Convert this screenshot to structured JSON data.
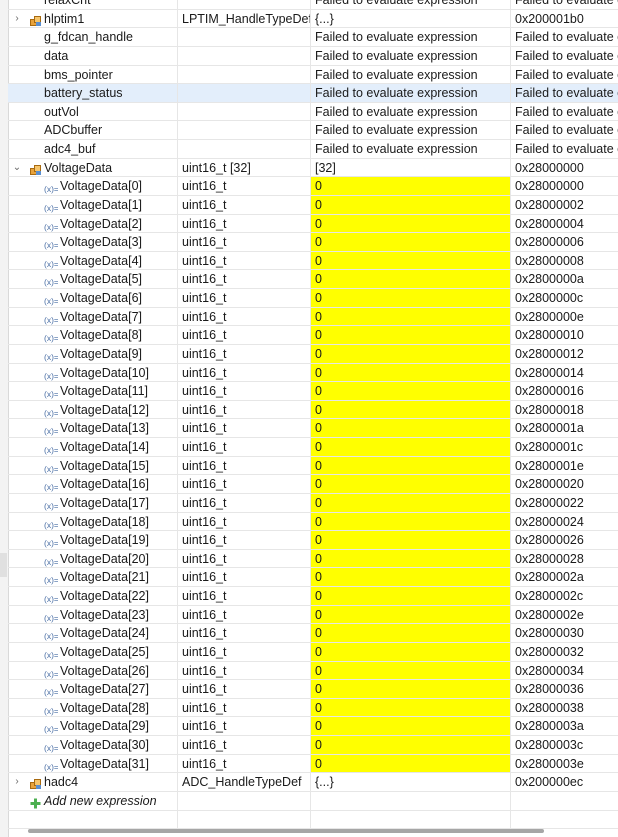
{
  "rows": [
    {
      "name": "relaxCnt",
      "type": "",
      "value": "Failed to evaluate expression",
      "address": "Failed to evaluate ex",
      "twisty": "",
      "icon": "",
      "indent": 0
    },
    {
      "name": "hlptim1",
      "type": "LPTIM_HandleTypeDef",
      "value": "{...}",
      "address": "0x200001b0",
      "twisty": ">",
      "icon": "struct",
      "indent": 0
    },
    {
      "name": "g_fdcan_handle",
      "type": "",
      "value": "Failed to evaluate expression",
      "address": "Failed to evaluate ex",
      "twisty": "",
      "icon": "",
      "indent": 0
    },
    {
      "name": "data",
      "type": "",
      "value": "Failed to evaluate expression",
      "address": "Failed to evaluate ex",
      "twisty": "",
      "icon": "",
      "indent": 0
    },
    {
      "name": "bms_pointer",
      "type": "",
      "value": "Failed to evaluate expression",
      "address": "Failed to evaluate ex",
      "twisty": "",
      "icon": "",
      "indent": 0
    },
    {
      "name": "battery_status",
      "type": "",
      "value": "Failed to evaluate expression",
      "address": "Failed to evaluate ex",
      "twisty": "",
      "icon": "",
      "indent": 0,
      "selected": true
    },
    {
      "name": "outVol",
      "type": "",
      "value": "Failed to evaluate expression",
      "address": "Failed to evaluate ex",
      "twisty": "",
      "icon": "",
      "indent": 0
    },
    {
      "name": "ADCbuffer",
      "type": "",
      "value": "Failed to evaluate expression",
      "address": "Failed to evaluate ex",
      "twisty": "",
      "icon": "",
      "indent": 0
    },
    {
      "name": "adc4_buf",
      "type": "",
      "value": "Failed to evaluate expression",
      "address": "Failed to evaluate ex",
      "twisty": "",
      "icon": "",
      "indent": 0
    },
    {
      "name": "VoltageData",
      "type": "uint16_t [32]",
      "value": "[32]",
      "address": "0x28000000",
      "twisty": "v",
      "icon": "struct",
      "indent": 0
    },
    {
      "name": "VoltageData[0]",
      "type": "uint16_t",
      "value": "0",
      "address": "0x28000000",
      "twisty": "",
      "icon": "var",
      "indent": 1,
      "highlight": true
    },
    {
      "name": "VoltageData[1]",
      "type": "uint16_t",
      "value": "0",
      "address": "0x28000002",
      "twisty": "",
      "icon": "var",
      "indent": 1,
      "highlight": true
    },
    {
      "name": "VoltageData[2]",
      "type": "uint16_t",
      "value": "0",
      "address": "0x28000004",
      "twisty": "",
      "icon": "var",
      "indent": 1,
      "highlight": true
    },
    {
      "name": "VoltageData[3]",
      "type": "uint16_t",
      "value": "0",
      "address": "0x28000006",
      "twisty": "",
      "icon": "var",
      "indent": 1,
      "highlight": true
    },
    {
      "name": "VoltageData[4]",
      "type": "uint16_t",
      "value": "0",
      "address": "0x28000008",
      "twisty": "",
      "icon": "var",
      "indent": 1,
      "highlight": true
    },
    {
      "name": "VoltageData[5]",
      "type": "uint16_t",
      "value": "0",
      "address": "0x2800000a",
      "twisty": "",
      "icon": "var",
      "indent": 1,
      "highlight": true
    },
    {
      "name": "VoltageData[6]",
      "type": "uint16_t",
      "value": "0",
      "address": "0x2800000c",
      "twisty": "",
      "icon": "var",
      "indent": 1,
      "highlight": true
    },
    {
      "name": "VoltageData[7]",
      "type": "uint16_t",
      "value": "0",
      "address": "0x2800000e",
      "twisty": "",
      "icon": "var",
      "indent": 1,
      "highlight": true
    },
    {
      "name": "VoltageData[8]",
      "type": "uint16_t",
      "value": "0",
      "address": "0x28000010",
      "twisty": "",
      "icon": "var",
      "indent": 1,
      "highlight": true
    },
    {
      "name": "VoltageData[9]",
      "type": "uint16_t",
      "value": "0",
      "address": "0x28000012",
      "twisty": "",
      "icon": "var",
      "indent": 1,
      "highlight": true
    },
    {
      "name": "VoltageData[10]",
      "type": "uint16_t",
      "value": "0",
      "address": "0x28000014",
      "twisty": "",
      "icon": "var",
      "indent": 1,
      "highlight": true
    },
    {
      "name": "VoltageData[11]",
      "type": "uint16_t",
      "value": "0",
      "address": "0x28000016",
      "twisty": "",
      "icon": "var",
      "indent": 1,
      "highlight": true
    },
    {
      "name": "VoltageData[12]",
      "type": "uint16_t",
      "value": "0",
      "address": "0x28000018",
      "twisty": "",
      "icon": "var",
      "indent": 1,
      "highlight": true
    },
    {
      "name": "VoltageData[13]",
      "type": "uint16_t",
      "value": "0",
      "address": "0x2800001a",
      "twisty": "",
      "icon": "var",
      "indent": 1,
      "highlight": true
    },
    {
      "name": "VoltageData[14]",
      "type": "uint16_t",
      "value": "0",
      "address": "0x2800001c",
      "twisty": "",
      "icon": "var",
      "indent": 1,
      "highlight": true
    },
    {
      "name": "VoltageData[15]",
      "type": "uint16_t",
      "value": "0",
      "address": "0x2800001e",
      "twisty": "",
      "icon": "var",
      "indent": 1,
      "highlight": true
    },
    {
      "name": "VoltageData[16]",
      "type": "uint16_t",
      "value": "0",
      "address": "0x28000020",
      "twisty": "",
      "icon": "var",
      "indent": 1,
      "highlight": true
    },
    {
      "name": "VoltageData[17]",
      "type": "uint16_t",
      "value": "0",
      "address": "0x28000022",
      "twisty": "",
      "icon": "var",
      "indent": 1,
      "highlight": true
    },
    {
      "name": "VoltageData[18]",
      "type": "uint16_t",
      "value": "0",
      "address": "0x28000024",
      "twisty": "",
      "icon": "var",
      "indent": 1,
      "highlight": true
    },
    {
      "name": "VoltageData[19]",
      "type": "uint16_t",
      "value": "0",
      "address": "0x28000026",
      "twisty": "",
      "icon": "var",
      "indent": 1,
      "highlight": true
    },
    {
      "name": "VoltageData[20]",
      "type": "uint16_t",
      "value": "0",
      "address": "0x28000028",
      "twisty": "",
      "icon": "var",
      "indent": 1,
      "highlight": true
    },
    {
      "name": "VoltageData[21]",
      "type": "uint16_t",
      "value": "0",
      "address": "0x2800002a",
      "twisty": "",
      "icon": "var",
      "indent": 1,
      "highlight": true
    },
    {
      "name": "VoltageData[22]",
      "type": "uint16_t",
      "value": "0",
      "address": "0x2800002c",
      "twisty": "",
      "icon": "var",
      "indent": 1,
      "highlight": true
    },
    {
      "name": "VoltageData[23]",
      "type": "uint16_t",
      "value": "0",
      "address": "0x2800002e",
      "twisty": "",
      "icon": "var",
      "indent": 1,
      "highlight": true
    },
    {
      "name": "VoltageData[24]",
      "type": "uint16_t",
      "value": "0",
      "address": "0x28000030",
      "twisty": "",
      "icon": "var",
      "indent": 1,
      "highlight": true
    },
    {
      "name": "VoltageData[25]",
      "type": "uint16_t",
      "value": "0",
      "address": "0x28000032",
      "twisty": "",
      "icon": "var",
      "indent": 1,
      "highlight": true
    },
    {
      "name": "VoltageData[26]",
      "type": "uint16_t",
      "value": "0",
      "address": "0x28000034",
      "twisty": "",
      "icon": "var",
      "indent": 1,
      "highlight": true
    },
    {
      "name": "VoltageData[27]",
      "type": "uint16_t",
      "value": "0",
      "address": "0x28000036",
      "twisty": "",
      "icon": "var",
      "indent": 1,
      "highlight": true
    },
    {
      "name": "VoltageData[28]",
      "type": "uint16_t",
      "value": "0",
      "address": "0x28000038",
      "twisty": "",
      "icon": "var",
      "indent": 1,
      "highlight": true
    },
    {
      "name": "VoltageData[29]",
      "type": "uint16_t",
      "value": "0",
      "address": "0x2800003a",
      "twisty": "",
      "icon": "var",
      "indent": 1,
      "highlight": true
    },
    {
      "name": "VoltageData[30]",
      "type": "uint16_t",
      "value": "0",
      "address": "0x2800003c",
      "twisty": "",
      "icon": "var",
      "indent": 1,
      "highlight": true
    },
    {
      "name": "VoltageData[31]",
      "type": "uint16_t",
      "value": "0",
      "address": "0x2800003e",
      "twisty": "",
      "icon": "var",
      "indent": 1,
      "highlight": true
    },
    {
      "name": "hadc4",
      "type": "ADC_HandleTypeDef",
      "value": "{...}",
      "address": "0x200000ec",
      "twisty": ">",
      "icon": "struct",
      "indent": 0
    },
    {
      "name": "Add new expression",
      "type": "",
      "value": "",
      "address": "",
      "twisty": "",
      "icon": "add",
      "indent": 0,
      "italic": true
    },
    {
      "name": "",
      "type": "",
      "value": "",
      "address": "",
      "twisty": "",
      "icon": "",
      "indent": 0
    }
  ],
  "colors": {
    "highlight": "#ffff00",
    "selection": "#e3eefb",
    "structIcon": "#e8a33c",
    "varIcon": "#4a6fa5",
    "addIcon": "#4caf50"
  }
}
